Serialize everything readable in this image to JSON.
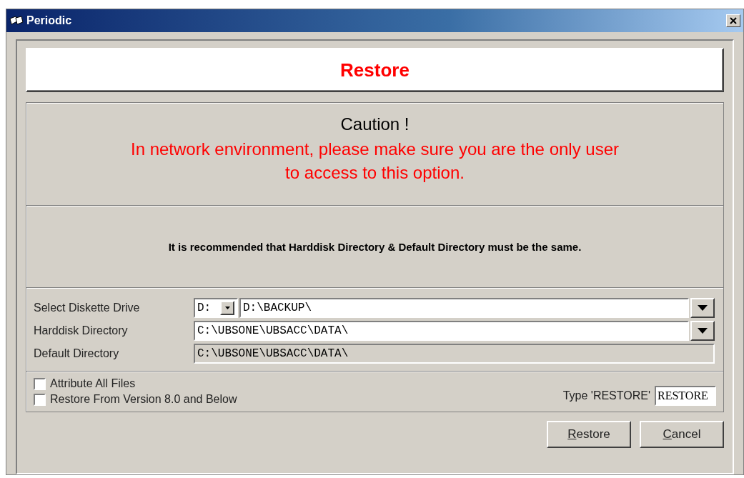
{
  "window": {
    "title": "Periodic"
  },
  "header": {
    "title": "Restore"
  },
  "caution": {
    "heading": "Caution !",
    "message": "In network environment, please make sure you are the only user to access to this option."
  },
  "recommendation": "It is recommended that Harddisk Directory & Default Directory must be the same.",
  "fields": [
    {
      "kind": "drive",
      "label": "Select Diskette Drive",
      "drive": "D:",
      "value": "D:\\BACKUP\\",
      "disabled": false
    },
    {
      "kind": "combo",
      "label": "Harddisk Directory",
      "value": "C:\\UBSONE\\UBSACC\\DATA\\",
      "disabled": false
    },
    {
      "kind": "text",
      "label": "Default Directory",
      "value": "C:\\UBSONE\\UBSACC\\DATA\\",
      "disabled": true
    }
  ],
  "options": [
    {
      "label": "Attribute All Files",
      "checked": false
    },
    {
      "label": "Restore From Version 8.0 and Below",
      "checked": false
    }
  ],
  "confirm": {
    "label": "Type 'RESTORE'",
    "value": "RESTORE"
  },
  "buttons": [
    {
      "label": "Restore",
      "underline_first": true
    },
    {
      "label": "Cancel",
      "underline_first": true
    }
  ]
}
